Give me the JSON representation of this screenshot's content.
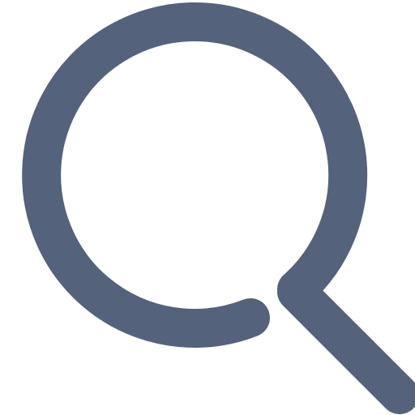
{
  "icon": {
    "name": "search-icon",
    "color": "#55627b",
    "background": "#ffffff"
  }
}
